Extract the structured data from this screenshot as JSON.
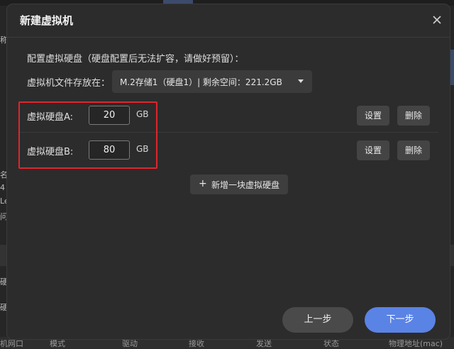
{
  "dialog": {
    "title": "新建虚拟机",
    "section_label": "配置虚拟硬盘（硬盘配置后无法扩容，请做好预留）：",
    "path_label": "虚拟机文件存放在：",
    "storage_select": "M.2存储1（硬盘1）| 剩余空间：221.2GB",
    "disks": [
      {
        "label": "虚拟硬盘A:",
        "size": "20",
        "unit": "GB",
        "settings": "设置",
        "delete": "删除"
      },
      {
        "label": "虚拟硬盘B:",
        "size": "80",
        "unit": "GB",
        "settings": "设置",
        "delete": "删除"
      }
    ],
    "add_disk": "新增一块虚拟硬盘",
    "prev": "上一步",
    "next": "下一步"
  },
  "background": {
    "footer_columns": [
      "机网口",
      "模式",
      "驱动",
      "接收",
      "发送",
      "状态",
      "物理地址(mac)"
    ],
    "side_glyphs": [
      "称",
      "名",
      "4",
      "Le",
      "问",
      "硬",
      "硬"
    ]
  },
  "colors": {
    "accent": "#5a83e6",
    "highlight": "#e0252d"
  }
}
